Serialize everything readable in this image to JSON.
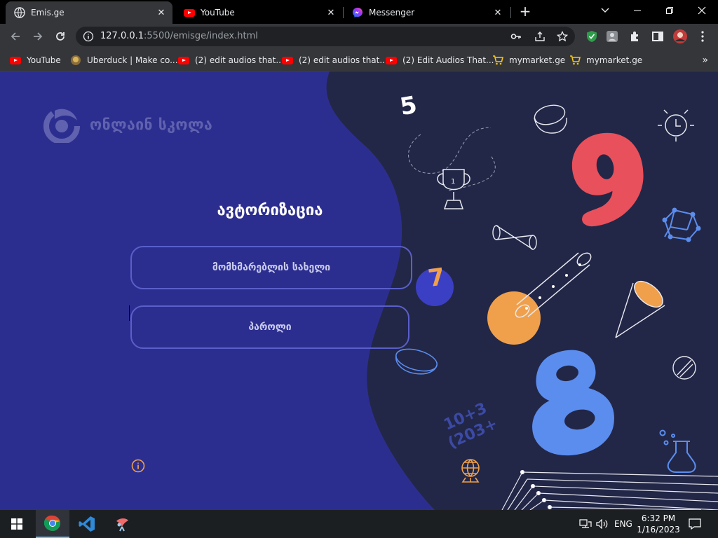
{
  "browser": {
    "tabs": [
      {
        "title": "Emis.ge",
        "active": true
      },
      {
        "title": "YouTube",
        "active": false
      },
      {
        "title": "Messenger",
        "active": false
      }
    ],
    "url_host": "127.0.0.1",
    "url_rest": ":5500/emisge/index.html"
  },
  "bookmarks": [
    {
      "label": "YouTube",
      "icon": "youtube-icon"
    },
    {
      "label": "Uberduck | Make co...",
      "icon": "uberduck-icon"
    },
    {
      "label": "(2) edit audios that...",
      "icon": "youtube-icon"
    },
    {
      "label": "(2) edit audios that...",
      "icon": "youtube-icon"
    },
    {
      "label": "(2) Edit Audios That...",
      "icon": "youtube-icon"
    },
    {
      "label": "mymarket.ge",
      "icon": "cart-icon"
    },
    {
      "label": "mymarket.ge",
      "icon": "cart-icon"
    }
  ],
  "page": {
    "logo_text": "ონლაინ სკოლა",
    "title": "ავტორიზაცია",
    "username_placeholder": "მომხმარებლის სახელი",
    "password_placeholder": "პაროლი",
    "decor": {
      "num5": "5",
      "num7": "7",
      "num8": "8",
      "num9": "9",
      "math1": "10+3",
      "math2": "(203+"
    }
  },
  "taskbar": {
    "lang": "ENG",
    "time": "6:32 PM",
    "date": "1/16/2023"
  },
  "colors": {
    "page_bg": "#2c2e8f",
    "panel_bg": "#222747",
    "field_border": "#5a5fc9",
    "accent_red": "#e8505b",
    "accent_orange": "#f0a04b",
    "accent_blue": "#5b8def"
  }
}
